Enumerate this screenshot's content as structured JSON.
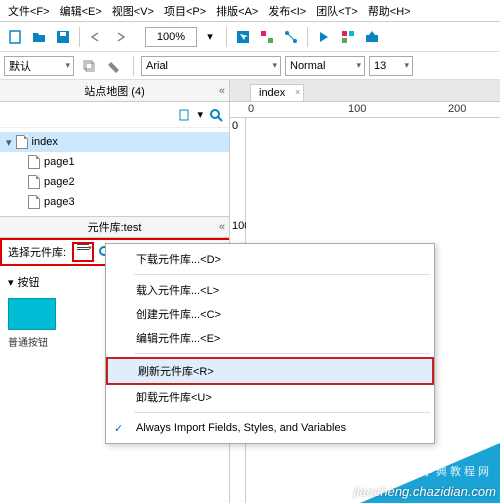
{
  "menu": {
    "file": "文件<F>",
    "edit": "编辑<E>",
    "view": "视图<V>",
    "project": "项目<P>",
    "arrange": "排版<A>",
    "publish": "发布<I>",
    "team": "团队<T>",
    "help": "帮助<H>"
  },
  "toolbar": {
    "zoom": "100%",
    "font_default": "默认",
    "font_family": "Arial",
    "font_weight": "Normal",
    "font_size": "13"
  },
  "sitemap": {
    "title": "站点地图 (4)",
    "root": "index",
    "pages": [
      "page1",
      "page2",
      "page3"
    ]
  },
  "library": {
    "title": "元件库:test",
    "selector_label": "选择元件库:",
    "section": "按钮",
    "widget_label": "普通按钮"
  },
  "canvas": {
    "tab": "index",
    "ruler_marks_h": [
      "0",
      "100",
      "200"
    ],
    "ruler_marks_v": [
      "0",
      "100"
    ]
  },
  "context_menu": {
    "download": "下载元件库...<D>",
    "load": "载入元件库...<L>",
    "create": "创建元件库...<C>",
    "edit": "编辑元件库...<E>",
    "refresh": "刷新元件库<R>",
    "unload": "卸载元件库<U>",
    "always_import": "Always Import Fields, Styles, and Variables"
  },
  "watermark": {
    "line1": "脚字典教程网",
    "line2": "jiaocheng.chazidian.com"
  }
}
